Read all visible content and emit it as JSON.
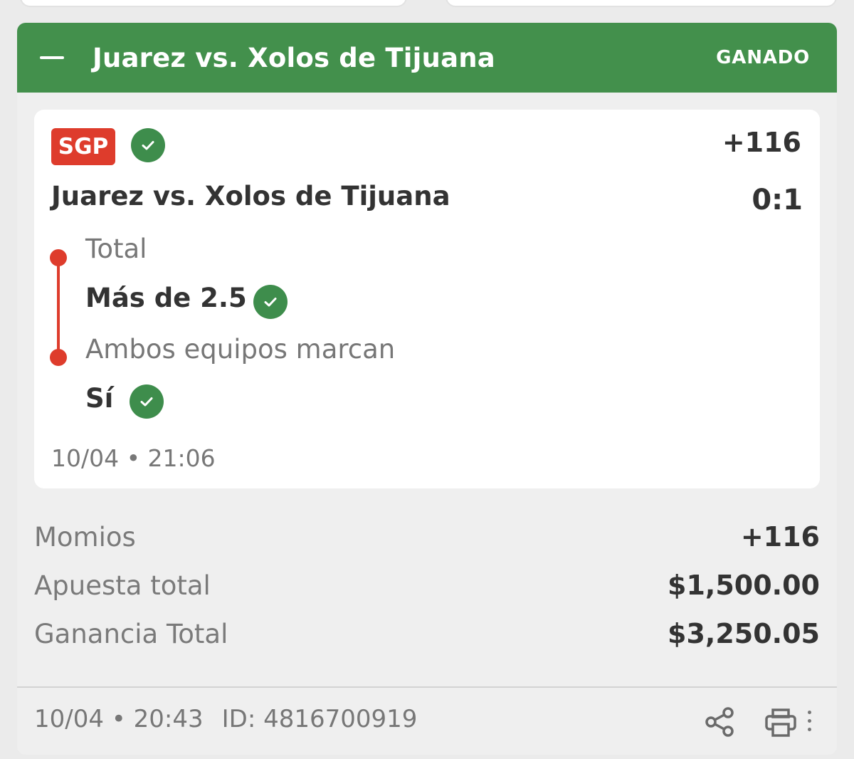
{
  "header": {
    "title": "Juarez vs. Xolos de Tijuana",
    "status": "GANADO",
    "color": "#43904c"
  },
  "bet": {
    "badge": "SGP",
    "odds": "+116",
    "event": "Juarez vs. Xolos de Tijuana",
    "score": "0:1",
    "legs": [
      {
        "market": "Total",
        "selection": "Más de 2.5",
        "status_icon": "check-circle-icon"
      },
      {
        "market": "Ambos equipos marcan",
        "selection": "Sí",
        "status_icon": "check-circle-icon"
      }
    ],
    "placed": "10/04 • 21:06"
  },
  "summary": [
    {
      "label": "Momios",
      "value": "+116"
    },
    {
      "label": "Apuesta total",
      "value": "$1,500.00"
    },
    {
      "label": "Ganancia Total",
      "value": "$3,250.05"
    }
  ],
  "footer": {
    "datetime": "10/04 • 20:43",
    "id": "ID: 4816700919",
    "icons": [
      "share-icon",
      "print-icon",
      "more-vertical-icon"
    ]
  },
  "colors": {
    "win_green": "#3e8d4c",
    "sgp_red": "#de3c2c"
  }
}
